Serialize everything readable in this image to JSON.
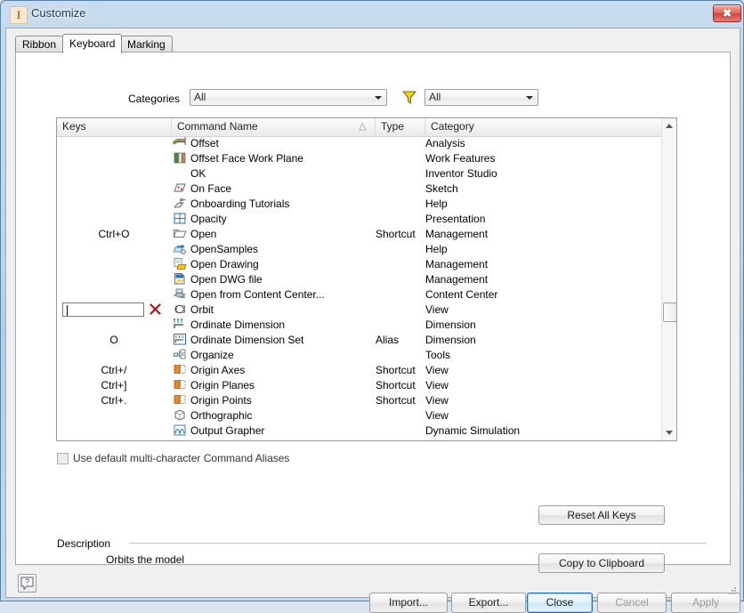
{
  "window": {
    "title": "Customize",
    "app_icon": "I",
    "close_label": "✖"
  },
  "tabs": [
    {
      "label": "Ribbon",
      "active": false
    },
    {
      "label": "Keyboard",
      "active": true
    },
    {
      "label": "Marking Menu",
      "active": false
    }
  ],
  "filters": {
    "categories_label": "Categories",
    "categories_value": "All",
    "filter_icon": "funnel-icon",
    "filter_value": "All"
  },
  "list": {
    "columns": [
      {
        "key": "keys",
        "label": "Keys"
      },
      {
        "key": "name",
        "label": "Command Name",
        "sorted": "ascending"
      },
      {
        "key": "type",
        "label": "Type"
      },
      {
        "key": "category",
        "label": "Category"
      },
      {
        "key": "spacer",
        "label": ""
      }
    ],
    "rows": [
      {
        "keys": "",
        "icon": "offset-icon",
        "name": "Offset",
        "type": "",
        "category": "Analysis"
      },
      {
        "keys": "",
        "icon": "offset-face-work-plane-icon",
        "name": "Offset Face Work Plane",
        "type": "",
        "category": "Work Features"
      },
      {
        "keys": "",
        "icon": "none",
        "name": "OK",
        "type": "",
        "category": "Inventor Studio"
      },
      {
        "keys": "",
        "icon": "on-face-icon",
        "name": "On Face",
        "type": "",
        "category": "Sketch"
      },
      {
        "keys": "",
        "icon": "onboarding-tutorials-icon",
        "name": "Onboarding Tutorials",
        "type": "",
        "category": "Help"
      },
      {
        "keys": "",
        "icon": "opacity-icon",
        "name": "Opacity",
        "type": "",
        "category": "Presentation"
      },
      {
        "keys": "Ctrl+O",
        "icon": "open-folder-icon",
        "name": "Open",
        "type": "Shortcut",
        "category": "Management"
      },
      {
        "keys": "",
        "icon": "open-samples-icon",
        "name": "OpenSamples",
        "type": "",
        "category": "Help"
      },
      {
        "keys": "",
        "icon": "open-drawing-icon",
        "name": "Open Drawing",
        "type": "",
        "category": "Management"
      },
      {
        "keys": "",
        "icon": "open-dwg-file-icon",
        "name": "Open DWG file",
        "type": "",
        "category": "Management"
      },
      {
        "keys": "",
        "icon": "open-content-center-icon",
        "name": "Open from Content Center...",
        "type": "",
        "category": "Content Center"
      },
      {
        "keys": "__EDIT__",
        "icon": "orbit-icon",
        "name": "Orbit",
        "type": "",
        "category": "View"
      },
      {
        "keys": "",
        "icon": "ordinate-dimension-icon",
        "name": "Ordinate Dimension",
        "type": "",
        "category": "Dimension"
      },
      {
        "keys": "O",
        "icon": "ordinate-dimension-set-icon",
        "name": "Ordinate Dimension Set",
        "type": "Alias",
        "category": "Dimension"
      },
      {
        "keys": "",
        "icon": "organize-icon",
        "name": "Organize",
        "type": "",
        "category": "Tools"
      },
      {
        "keys": "Ctrl+/",
        "icon": "origin-axes-icon",
        "name": "Origin Axes",
        "type": "Shortcut",
        "category": "View"
      },
      {
        "keys": "Ctrl+]",
        "icon": "origin-planes-icon",
        "name": "Origin Planes",
        "type": "Shortcut",
        "category": "View"
      },
      {
        "keys": "Ctrl+.",
        "icon": "origin-points-icon",
        "name": "Origin Points",
        "type": "Shortcut",
        "category": "View"
      },
      {
        "keys": "",
        "icon": "orthographic-icon",
        "name": "Orthographic",
        "type": "",
        "category": "View"
      },
      {
        "keys": "",
        "icon": "output-grapher-icon",
        "name": "Output Grapher",
        "type": "",
        "category": "Dynamic Simulation"
      }
    ],
    "key_editor": {
      "value": "",
      "clear_icon": "red-x-icon"
    },
    "scrollbar": {
      "up_icon": "scroll-up-arrow",
      "down_icon": "scroll-down-arrow"
    }
  },
  "options": {
    "use_default_aliases_label": "Use default multi-character Command Aliases",
    "use_default_aliases_checked": false
  },
  "actions": {
    "reset_all_keys": "Reset All Keys",
    "copy_to_clipboard": "Copy to Clipboard"
  },
  "description": {
    "label": "Description",
    "text": "Orbits the model"
  },
  "footer": {
    "help_icon": "help-question-icon",
    "import": "Import...",
    "export": "Export...",
    "close": "Close",
    "cancel": "Cancel",
    "apply": "Apply"
  },
  "colors": {
    "accent": "#2c6ca8",
    "titlebar": "#bcd4e9",
    "close_button": "#cf4439",
    "filter_icon": "#f2cf1e",
    "clear_icon": "#9e1b1b"
  }
}
